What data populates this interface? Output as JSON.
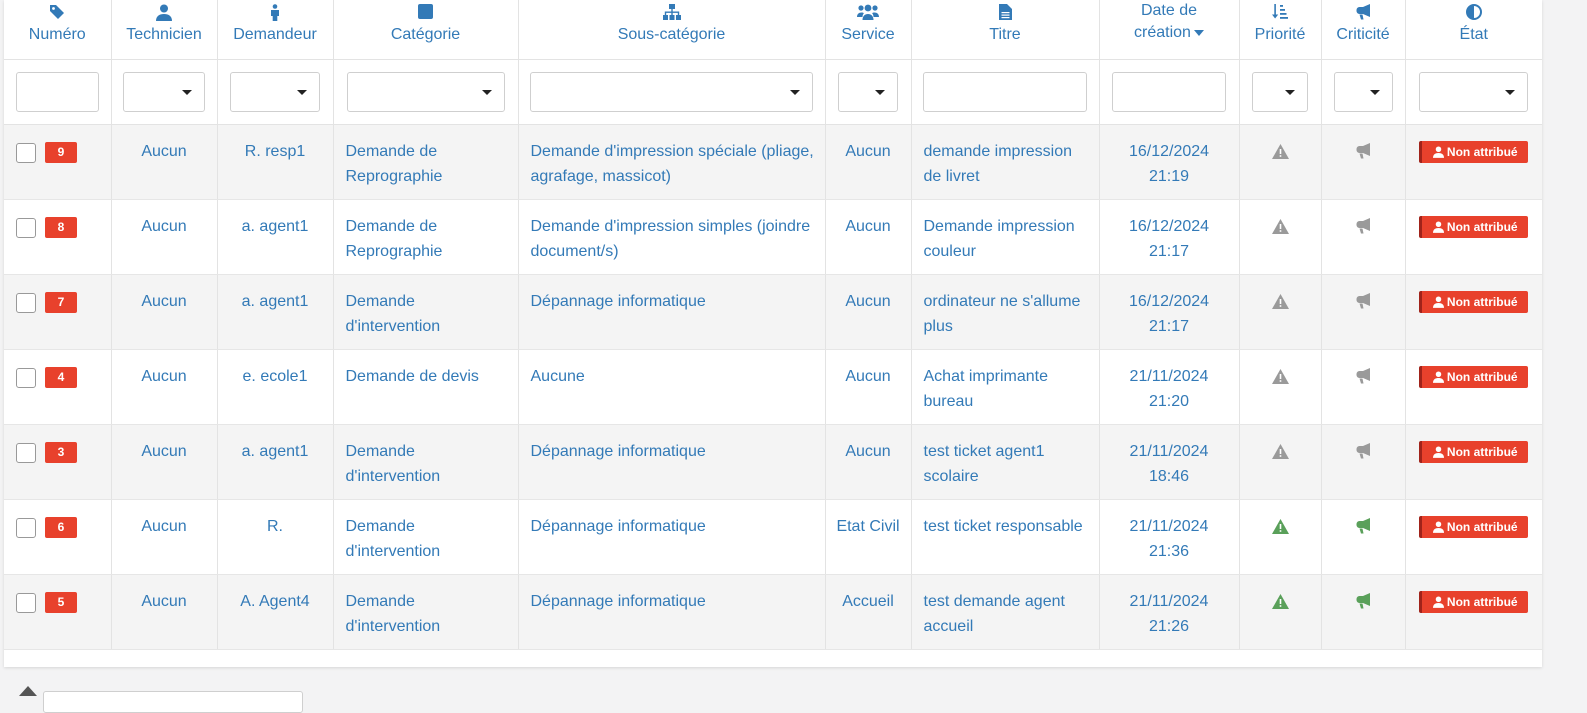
{
  "columns": {
    "numero": "Numéro",
    "technicien": "Technicien",
    "demandeur": "Demandeur",
    "categorie": "Catégorie",
    "sous_categorie": "Sous-catégorie",
    "service": "Service",
    "titre": "Titre",
    "date_line1": "Date de",
    "date_line2": "création",
    "priorite": "Priorité",
    "criticite": "Criticité",
    "etat": "État"
  },
  "status_label": "Non attribué",
  "colors": {
    "accent": "#337ab7",
    "danger": "#e8412c",
    "icon_grey": "#9a9a9a",
    "icon_green": "#5aa05a"
  },
  "rows": [
    {
      "id": "9",
      "technicien": "Aucun",
      "demandeur": "R. resp1",
      "categorie": "Demande de Reprographie",
      "sous_categorie": "Demande d'impression spéciale (pliage, agrafage, massicot)",
      "service": "Aucun",
      "titre": "demande impression de livret",
      "date": "16/12/2024",
      "time": "21:19",
      "priority_color": "grey"
    },
    {
      "id": "8",
      "technicien": "Aucun",
      "demandeur": "a. agent1",
      "categorie": "Demande de Reprographie",
      "sous_categorie": "Demande d'impression simples (joindre document/s)",
      "service": "Aucun",
      "titre": "Demande impression couleur",
      "date": "16/12/2024",
      "time": "21:17",
      "priority_color": "grey"
    },
    {
      "id": "7",
      "technicien": "Aucun",
      "demandeur": "a. agent1",
      "categorie": "Demande d'intervention",
      "sous_categorie": "Dépannage informatique",
      "service": "Aucun",
      "titre": "ordinateur ne s'allume plus",
      "date": "16/12/2024",
      "time": "21:17",
      "priority_color": "grey"
    },
    {
      "id": "4",
      "technicien": "Aucun",
      "demandeur": "e. ecole1",
      "categorie": "Demande de devis",
      "sous_categorie": "Aucune",
      "service": "Aucun",
      "titre": "Achat imprimante bureau",
      "date": "21/11/2024",
      "time": "21:20",
      "priority_color": "grey"
    },
    {
      "id": "3",
      "technicien": "Aucun",
      "demandeur": "a. agent1",
      "categorie": "Demande d'intervention",
      "sous_categorie": "Dépannage informatique",
      "service": "Aucun",
      "titre": "test ticket agent1 scolaire",
      "date": "21/11/2024",
      "time": "18:46",
      "priority_color": "grey"
    },
    {
      "id": "6",
      "technicien": "Aucun",
      "demandeur": "R.",
      "categorie": "Demande d'intervention",
      "sous_categorie": "Dépannage informatique",
      "service": "Etat Civil",
      "titre": "test ticket responsable",
      "date": "21/11/2024",
      "time": "21:36",
      "priority_color": "green"
    },
    {
      "id": "5",
      "technicien": "Aucun",
      "demandeur": "A. Agent4",
      "categorie": "Demande d'intervention",
      "sous_categorie": "Dépannage informatique",
      "service": "Accueil",
      "titre": "test demande agent accueil",
      "date": "21/11/2024",
      "time": "21:26",
      "priority_color": "green"
    }
  ]
}
